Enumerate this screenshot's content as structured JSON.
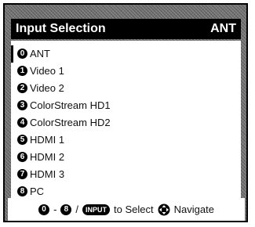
{
  "menu": {
    "title": "Input Selection",
    "current_input": "ANT",
    "items": [
      {
        "number": "0",
        "label": "ANT",
        "selected": true
      },
      {
        "number": "1",
        "label": "Video 1"
      },
      {
        "number": "2",
        "label": "Video 2"
      },
      {
        "number": "3",
        "label": "ColorStream HD1"
      },
      {
        "number": "4",
        "label": "ColorStream HD2"
      },
      {
        "number": "5",
        "label": "HDMI 1"
      },
      {
        "number": "6",
        "label": "HDMI 2"
      },
      {
        "number": "7",
        "label": "HDMI 3"
      },
      {
        "number": "8",
        "label": "PC"
      }
    ]
  },
  "footer": {
    "range_start": "0",
    "range_separator": "-",
    "range_end": "8",
    "slash": "/",
    "input_key_label": "INPUT",
    "select_text": "to Select",
    "navigate_text": "Navigate",
    "navigate_icon": "dpad-icon"
  }
}
